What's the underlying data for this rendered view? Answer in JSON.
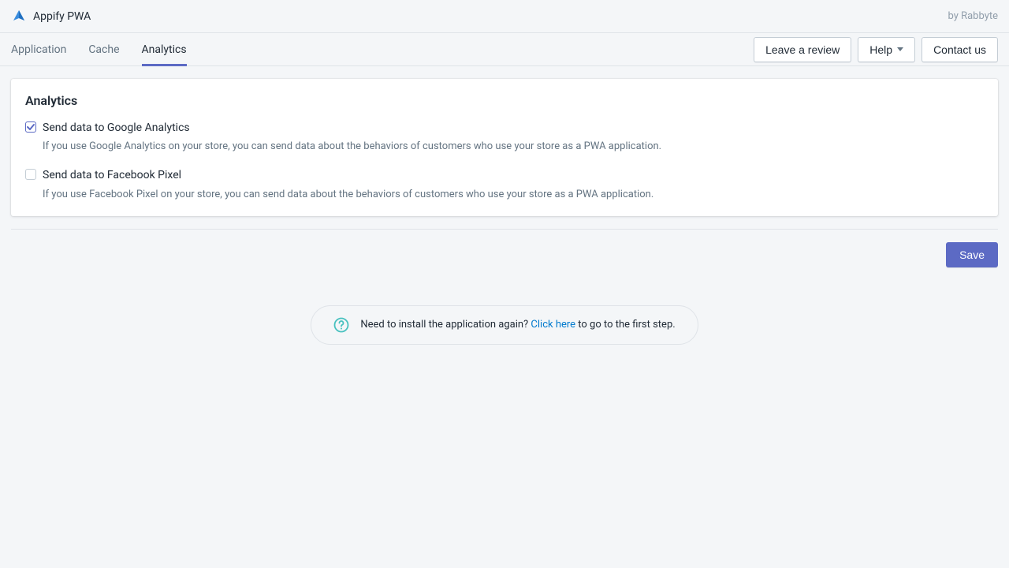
{
  "header": {
    "title": "Appify PWA",
    "byline": "by Rabbyte"
  },
  "tabs": {
    "application": "Application",
    "cache": "Cache",
    "analytics": "Analytics"
  },
  "nav_actions": {
    "leave_review": "Leave a review",
    "help": "Help",
    "contact_us": "Contact us"
  },
  "card": {
    "title": "Analytics",
    "options": {
      "ga": {
        "label": "Send data to Google Analytics",
        "desc": "If you use Google Analytics on your store, you can send data about the behaviors of customers who use your store as a PWA application."
      },
      "fb": {
        "label": "Send data to Facebook Pixel",
        "desc": "If you use Facebook Pixel on your store, you can send data about the behaviors of customers who use your store as a PWA application."
      }
    }
  },
  "save_button": "Save",
  "callout": {
    "prefix": "Need to install the application again? ",
    "link": "Click here",
    "suffix": " to go to the first step."
  }
}
